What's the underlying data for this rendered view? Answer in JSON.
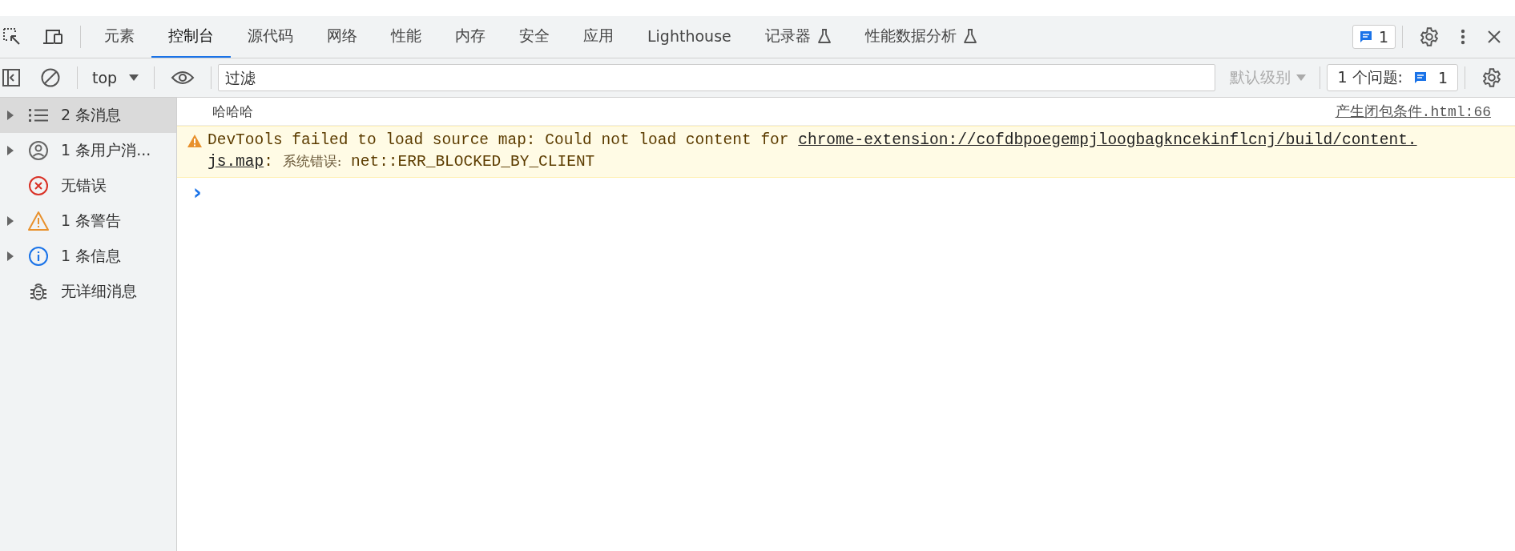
{
  "tabs": [
    {
      "label": "元素",
      "selected": false,
      "experimental": false
    },
    {
      "label": "控制台",
      "selected": true,
      "experimental": false
    },
    {
      "label": "源代码",
      "selected": false,
      "experimental": false
    },
    {
      "label": "网络",
      "selected": false,
      "experimental": false
    },
    {
      "label": "性能",
      "selected": false,
      "experimental": false
    },
    {
      "label": "内存",
      "selected": false,
      "experimental": false
    },
    {
      "label": "安全",
      "selected": false,
      "experimental": false
    },
    {
      "label": "应用",
      "selected": false,
      "experimental": false
    },
    {
      "label": "Lighthouse",
      "selected": false,
      "experimental": false
    },
    {
      "label": "记录器",
      "selected": false,
      "experimental": true
    },
    {
      "label": "性能数据分析",
      "selected": false,
      "experimental": true
    }
  ],
  "issues_badge": "1",
  "toolbar": {
    "context": "top",
    "filter_placeholder": "过滤",
    "level": "默认级别",
    "issues_label": "1 个问题:",
    "issues_count": "1"
  },
  "sidebar": {
    "items": [
      {
        "kind": "list",
        "label": "2 条消息",
        "arrow": true,
        "selected": true
      },
      {
        "kind": "user",
        "label": "1 条用户消...",
        "arrow": true,
        "selected": false
      },
      {
        "kind": "error",
        "label": "无错误",
        "arrow": false,
        "selected": false
      },
      {
        "kind": "warning",
        "label": "1 条警告",
        "arrow": true,
        "selected": false
      },
      {
        "kind": "info",
        "label": "1 条信息",
        "arrow": true,
        "selected": false
      },
      {
        "kind": "verbose",
        "label": "无详细消息",
        "arrow": false,
        "selected": false
      }
    ]
  },
  "console": {
    "messages": [
      {
        "kind": "log",
        "text": "哈哈哈",
        "source": "产生闭包条件.html:66"
      },
      {
        "kind": "warning",
        "lines": [
          [
            {
              "kind": "text",
              "text": "DevTools failed to load source map: Could not load content for "
            },
            {
              "kind": "link",
              "text": "chrome-extension://cofdbpoegempjloogbagkncekinflcnj/build/content."
            }
          ],
          [
            {
              "kind": "link",
              "text": "js.map"
            },
            {
              "kind": "text",
              "text": ": "
            },
            {
              "kind": "note",
              "text": "系统错误:"
            },
            {
              "kind": "text",
              "text": " net::ERR_BLOCKED_BY_CLIENT"
            }
          ]
        ]
      }
    ],
    "prompt": "›"
  }
}
